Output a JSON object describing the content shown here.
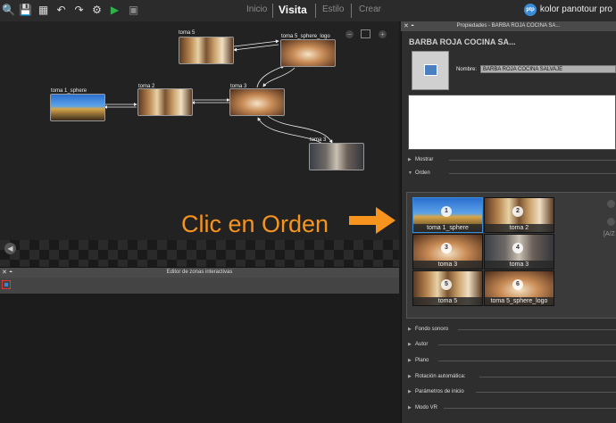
{
  "toolbar": {
    "icons": [
      "search-zoom-icon",
      "save-icon",
      "export-icon",
      "undo-icon",
      "redo-icon",
      "gear-icon",
      "play-icon",
      "output-icon"
    ],
    "tabs": [
      "Inicio",
      "Visita",
      "Estilo",
      "Crear"
    ],
    "active_tab": "Visita",
    "brand_text": "kolor panotour pro",
    "brand_badge": "ptp"
  },
  "tour_graph": {
    "nodes": [
      {
        "label": "toma 5"
      },
      {
        "label": "toma 5_sphere_logo"
      },
      {
        "label": "toma 1_sphere"
      },
      {
        "label": "toma 2"
      },
      {
        "label": "toma 3"
      },
      {
        "label": "toma 3"
      }
    ]
  },
  "interactive_editor": {
    "title": "Editor de zonas interactivas"
  },
  "properties": {
    "header": "Propiedades - BARBA ROJA COCINA SA...",
    "title": "BARBA ROJA COCINA SA...",
    "name_label": "Nombre:",
    "name_value": "BARBA ROJA COCINA SALVAJE",
    "sections_top": [
      "Mostrar",
      "Orden"
    ],
    "order_tiles": [
      {
        "num": "1",
        "caption": "toma 1_sphere"
      },
      {
        "num": "2",
        "caption": "toma 2"
      },
      {
        "num": "3",
        "caption": "toma 3"
      },
      {
        "num": "4",
        "caption": "toma 3"
      },
      {
        "num": "5",
        "caption": "toma 5"
      },
      {
        "num": "6",
        "caption": "toma 5_sphere_logo"
      }
    ],
    "sort_label": "[A/Z",
    "sections_bottom": [
      "Fondo sonoro",
      "Autor",
      "Plano",
      "Rotación automática:",
      "Parámetros de inicio",
      "Modo VR"
    ]
  },
  "annotation": {
    "text": "Clic en Orden",
    "color": "#f7941d"
  }
}
